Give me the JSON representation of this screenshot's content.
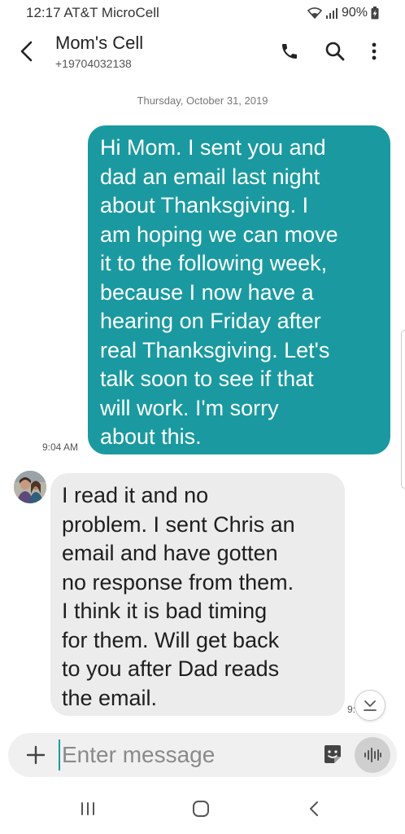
{
  "status_bar": {
    "time_carrier": "12:17 AT&T MicroCell",
    "battery": "90%"
  },
  "header": {
    "contact_name": "Mom's Cell",
    "contact_number": "+19704032138"
  },
  "conversation": {
    "date_separator": "Thursday, October 31, 2019",
    "messages": [
      {
        "direction": "sent",
        "lines": [
          "Hi Mom. I sent you and",
          "dad an email last night",
          "about Thanksgiving.  I",
          "am hoping we can move",
          "it to the following week,",
          "because I now have a",
          "hearing on Friday after",
          "real Thanksgiving.  Let's",
          "talk soon to see if that",
          "will work.  I'm sorry",
          "about this."
        ],
        "time": "9:04 AM"
      },
      {
        "direction": "received",
        "lines": [
          "I read it and no",
          "problem.  I sent Chris an",
          "email and have gotten",
          "no response from them.",
          "I think it is bad timing",
          "for them.  Will get back",
          "to you after Dad reads",
          "the email."
        ],
        "time": "9:"
      }
    ]
  },
  "composer": {
    "placeholder": "Enter message"
  },
  "colors": {
    "sent_bubble": "#1a9aa0",
    "received_bubble": "#ececec"
  },
  "icons": {
    "back": "back-arrow-icon",
    "call": "phone-icon",
    "search": "search-icon",
    "more": "more-vert-icon",
    "add": "plus-icon",
    "sticker": "sticker-icon",
    "voice": "voice-wave-icon",
    "scroll_down": "chevron-down-icon"
  }
}
